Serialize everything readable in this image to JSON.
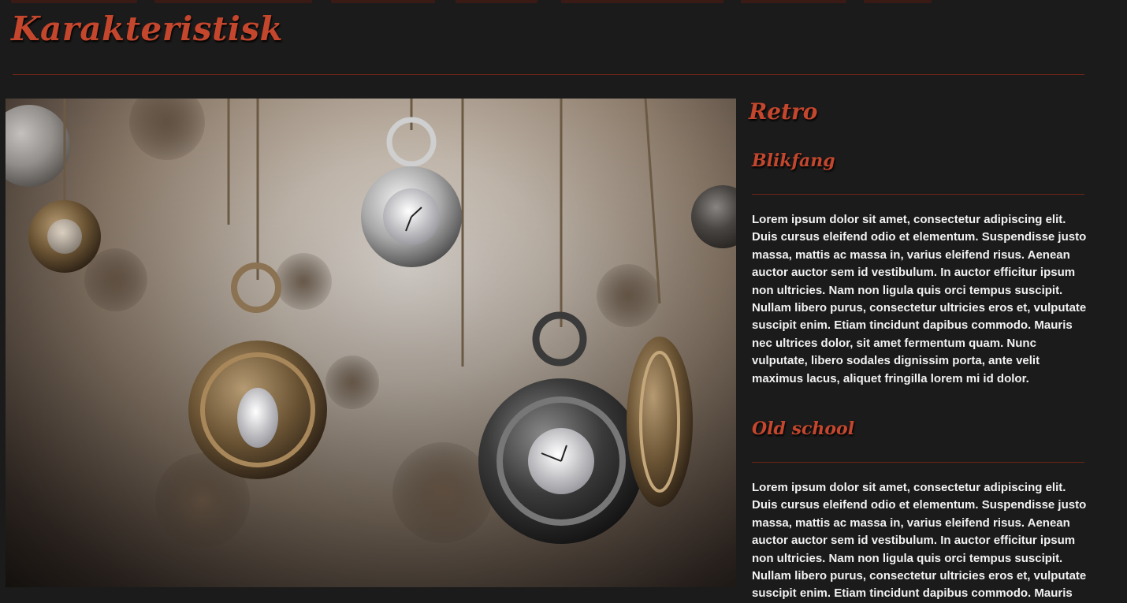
{
  "site": {
    "title": "Karakteristisk"
  },
  "hero": {
    "alt": "Hanging pocket watches"
  },
  "sidebar": {
    "title": "Retro",
    "sections": [
      {
        "heading": "Blikfang",
        "text": "Lorem ipsum dolor sit amet, consectetur adipiscing elit. Duis cursus eleifend odio et elementum. Suspendisse justo massa, mattis ac massa in, varius eleifend risus. Aenean auctor auctor sem id vestibulum. In auctor efficitur ipsum non ultricies. Nam non ligula quis orci tempus suscipit. Nullam libero purus, consectetur ultricies eros et, vulputate suscipit enim. Etiam tincidunt dapibus commodo. Mauris nec ultrices dolor, sit amet fermentum quam. Nunc vulputate, libero sodales dignissim porta, ante velit maximus lacus, aliquet fringilla lorem mi id dolor."
      },
      {
        "heading": "Old school",
        "text": "Lorem ipsum dolor sit amet, consectetur adipiscing elit. Duis cursus eleifend odio et elementum. Suspendisse justo massa, mattis ac massa in, varius eleifend risus. Aenean auctor auctor sem id vestibulum. In auctor efficitur ipsum non ultricies. Nam non ligula quis orci tempus suscipit. Nullam libero purus, consectetur ultricies eros et, vulputate suscipit enim. Etiam tincidunt dapibus commodo. Mauris"
      }
    ]
  },
  "colors": {
    "background": "#1b1b1b",
    "accent": "#c4472d",
    "rule": "#6a2417",
    "text": "#f2f2f2"
  }
}
